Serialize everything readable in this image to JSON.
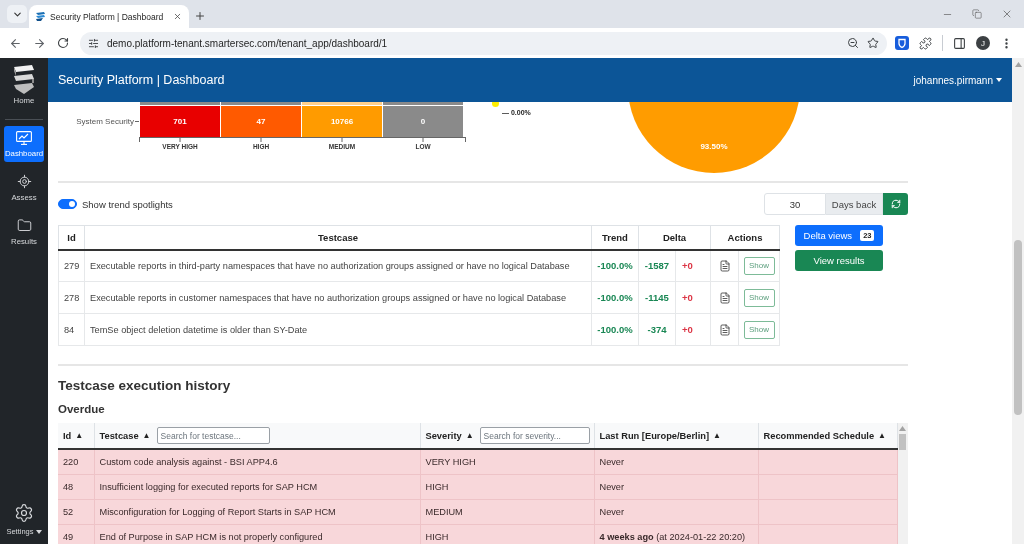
{
  "browser": {
    "tab": {
      "title": "Security Platform | Dashboard",
      "selected": true
    },
    "url": "demo.platform-tenant.smartersec.com/tenant_app/dashboard/1",
    "profile": "J"
  },
  "header": {
    "title": "Security Platform | Dashboard",
    "user": "johannes.pirmann"
  },
  "sidebar": {
    "items": [
      {
        "kind": "logo",
        "label": "Home",
        "selected": false
      },
      {
        "kind": "dashboard",
        "label": "Dashboard",
        "selected": true
      },
      {
        "kind": "assess",
        "label": "Assess",
        "selected": false
      },
      {
        "kind": "results",
        "label": "Results",
        "selected": false
      }
    ],
    "settings": {
      "label": "Settings"
    }
  },
  "heatmap": {
    "clipped_row": {
      "cells": [
        {
          "color": "#8a8a8a"
        },
        {
          "color": "#8a8a8a"
        },
        {
          "color": "#ffd08c"
        },
        {
          "color": "#8a8a8a"
        }
      ]
    },
    "rows": [
      {
        "label": "System Security",
        "cells": [
          {
            "value": "701",
            "color": "#e80000"
          },
          {
            "value": "47",
            "color": "#ff5a00"
          },
          {
            "value": "10766",
            "color": "#ff9b00"
          },
          {
            "value": "0",
            "color": "#8a8a8a"
          }
        ]
      }
    ],
    "x_axis": {
      "labels": [
        "VERY HIGH",
        "HIGH",
        "MEDIUM",
        "LOW"
      ]
    }
  },
  "pie": {
    "legend": [
      {
        "reading": "— 0.00%",
        "color": "#ffee00"
      }
    ],
    "slices": [
      {
        "label": "93.50%",
        "color": "#ff9c00"
      }
    ]
  },
  "trend": {
    "toggle": {
      "label": "Show trend spotlights",
      "on": true
    },
    "days_back": {
      "value": "30",
      "label": "Days back"
    },
    "columns": [
      "Id",
      "Testcase",
      "Trend",
      "Delta",
      "Actions"
    ],
    "rows": [
      {
        "id": "279",
        "testcase": "Executable reports in third-party namespaces that have no authorization groups assigned or have no logical Database",
        "trend": "-100.0%",
        "delta": "-1587",
        "added": "+0",
        "action": "Show"
      },
      {
        "id": "278",
        "testcase": "Executable reports in customer namespaces that have no authorization groups assigned or have no logical Database",
        "trend": "-100.0%",
        "delta": "-1145",
        "added": "+0",
        "action": "Show"
      },
      {
        "id": "84",
        "testcase": "TemSe object deletion datetime is older than SY-Date",
        "trend": "-100.0%",
        "delta": "-374",
        "added": "+0",
        "action": "Show"
      }
    ],
    "buttons": {
      "delta_views": {
        "label": "Delta views",
        "count": "23"
      },
      "view_results": {
        "label": "View results"
      }
    }
  },
  "history": {
    "title": "Testcase execution history",
    "section": "Overdue",
    "columns": [
      {
        "label": "Id",
        "sort": "▲"
      },
      {
        "label": "Testcase",
        "sort": "▲",
        "placeholder": "Search for testcase..."
      },
      {
        "label": "Severity",
        "sort": "▲",
        "placeholder": "Search for severity..."
      },
      {
        "label": "Last Run [Europe/Berlin]",
        "sort": "▲"
      },
      {
        "label": "Recommended Schedule",
        "sort": "▲"
      }
    ],
    "rows": [
      {
        "id": "220",
        "testcase": "Custom code analysis against - BSI APP4.6",
        "severity": "VERY HIGH",
        "last_run": "Never"
      },
      {
        "id": "48",
        "testcase": "Insufficient logging for executed reports for SAP HCM",
        "severity": "HIGH",
        "last_run": "Never"
      },
      {
        "id": "52",
        "testcase": "Misconfiguration for Logging of Report Starts in SAP HCM",
        "severity": "MEDIUM",
        "last_run": "Never"
      },
      {
        "id": "49",
        "testcase": "End of Purpose in SAP HCM is not properly configured",
        "severity": "HIGH",
        "last_run": "**4 weeks ago** (at 2024-01-22 20:20)"
      }
    ]
  }
}
